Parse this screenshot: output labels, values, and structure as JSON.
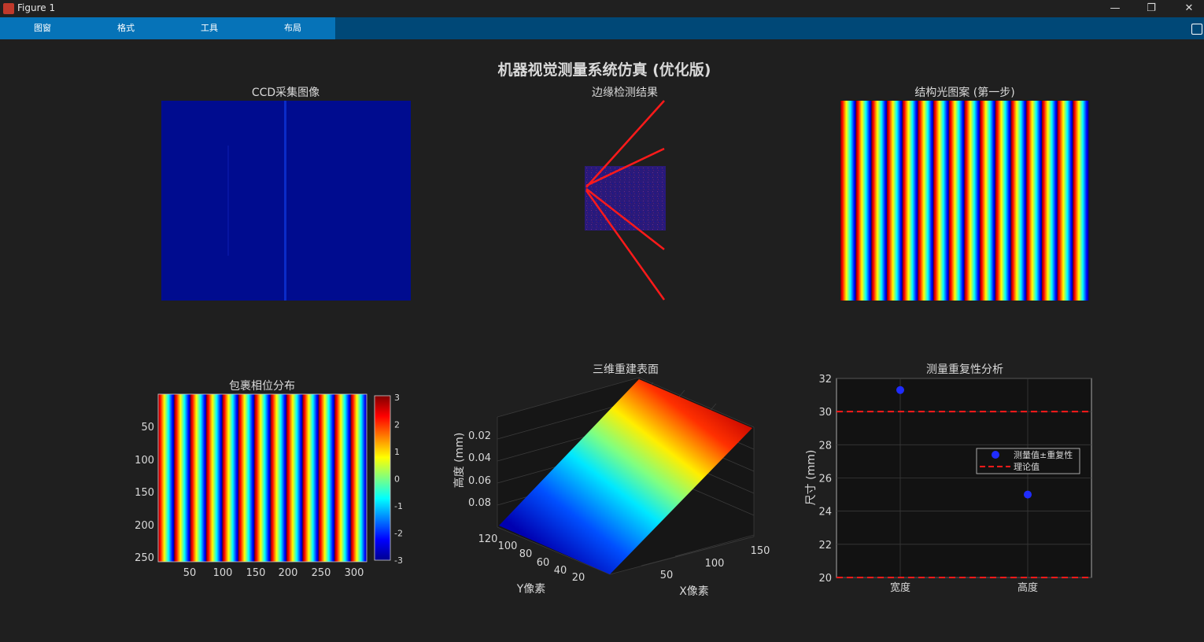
{
  "window": {
    "title": "Figure 1",
    "controls": {
      "minimize": "—",
      "restore": "❐",
      "close": "✕"
    }
  },
  "toolstrip": {
    "tabs": [
      {
        "label": "图窗"
      },
      {
        "label": "格式"
      },
      {
        "label": "工具"
      },
      {
        "label": "布局"
      }
    ]
  },
  "figure": {
    "suptitle": "机器视觉测量系统仿真 (优化版)",
    "colors": {
      "background": "#1f1f1f",
      "axes_bg": "#121212",
      "accent_red": "#ff1a1a",
      "marker_blue": "#1f2cff"
    }
  },
  "chart_data": [
    {
      "type": "heatmap",
      "title": "CCD采集图像",
      "description_colormap": "jet",
      "axis": "off"
    },
    {
      "type": "line",
      "title": "边缘检测结果",
      "axis": "off",
      "colormap": "noise image with red detected lines"
    },
    {
      "type": "heatmap",
      "title": "结构光图案 (第一步)",
      "colormap": "jet",
      "axis": "off",
      "stripes": 16
    },
    {
      "type": "heatmap",
      "title": "包裹相位分布",
      "colormap": "jet",
      "x_ticks": [
        "50",
        "100",
        "150",
        "200",
        "250",
        "300"
      ],
      "y_ticks": [
        "50",
        "100",
        "150",
        "200",
        "250"
      ],
      "colorbar_ticks": [
        "3",
        "2",
        "1",
        "0",
        "-1",
        "-2",
        "-3"
      ],
      "clim": [
        -3,
        3
      ],
      "stripes": 13
    },
    {
      "type": "area",
      "title": "三维重建表面",
      "xlabel": "X像素",
      "ylabel": "Y像素",
      "zlabel": "高度 (mm)",
      "x_ticks": [
        "50",
        "100",
        "150"
      ],
      "y_ticks": [
        "20",
        "40",
        "60",
        "80",
        "100",
        "120"
      ],
      "z_ticks": [
        "0.02",
        "0.04",
        "0.06",
        "0.08"
      ],
      "colormap": "jet"
    },
    {
      "type": "scatter",
      "title": "测量重复性分析",
      "ylabel": "尺寸 (mm)",
      "categories": [
        "宽度",
        "高度"
      ],
      "ylim": [
        20,
        32
      ],
      "y_ticks": [
        "20",
        "22",
        "24",
        "26",
        "28",
        "30",
        "32"
      ],
      "grid": true,
      "series": [
        {
          "name": "测量值±重复性",
          "values": [
            31.3,
            25.0
          ]
        },
        {
          "name": "理论值",
          "values": [
            30,
            20
          ]
        }
      ],
      "legend_position": "east"
    }
  ]
}
